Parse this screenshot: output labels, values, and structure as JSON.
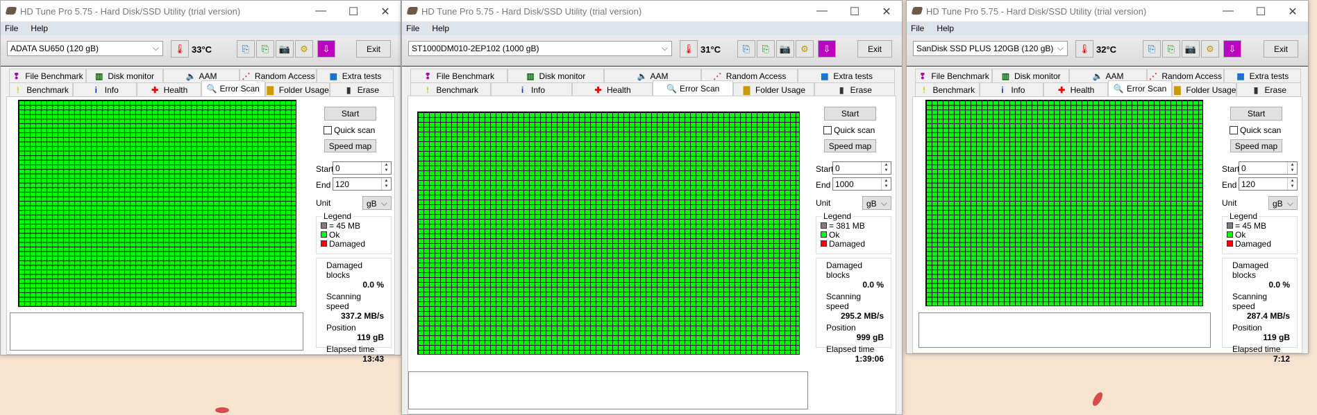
{
  "app_title": "HD Tune Pro 5.75 - Hard Disk/SSD Utility (trial version)",
  "menu": [
    "File",
    "Help"
  ],
  "exit_label": "Exit",
  "tabs_top": [
    {
      "label": "File Benchmark",
      "icon": "file-benchmark-icon"
    },
    {
      "label": "Disk monitor",
      "icon": "disk-monitor-icon"
    },
    {
      "label": "AAM",
      "icon": "speaker-icon"
    },
    {
      "label": "Random Access",
      "icon": "random-access-icon"
    },
    {
      "label": "Extra tests",
      "icon": "extra-tests-icon"
    }
  ],
  "tabs_bottom": [
    {
      "label": "Benchmark",
      "icon": "benchmark-icon"
    },
    {
      "label": "Info",
      "icon": "info-icon"
    },
    {
      "label": "Health",
      "icon": "health-cross-icon"
    },
    {
      "label": "Error Scan",
      "icon": "magnifier-icon",
      "active": true
    },
    {
      "label": "Folder Usage",
      "icon": "folder-icon"
    },
    {
      "label": "Erase",
      "icon": "trash-icon"
    }
  ],
  "panel_labels": {
    "start_button": "Start",
    "quick_scan": "Quick scan",
    "speed_map": "Speed map",
    "start": "Start",
    "end": "End",
    "unit": "Unit",
    "legend": "Legend",
    "ok": "Ok",
    "damaged": "Damaged",
    "damaged_blocks": "Damaged blocks",
    "scanning_speed": "Scanning speed",
    "position": "Position",
    "elapsed_time": "Elapsed time"
  },
  "colors": {
    "ok": "#00ff00",
    "damaged": "#ff0000",
    "block": "#808080",
    "exit_arrow": "#c000c0"
  },
  "windows": [
    {
      "drive": "ADATA SU650 (120 gB)",
      "temperature": "33°C",
      "start_value": "0",
      "end_value": "120",
      "unit": "gB",
      "block_size": "= 45 MB",
      "damaged_blocks": "0.0 %",
      "scanning_speed": "337.2 MB/s",
      "position": "119 gB",
      "elapsed_time": "13:43",
      "quick_scan_checked": false
    },
    {
      "drive": "ST1000DM010-2EP102 (1000 gB)",
      "temperature": "31°C",
      "start_value": "0",
      "end_value": "1000",
      "unit": "gB",
      "block_size": "= 381 MB",
      "damaged_blocks": "0.0 %",
      "scanning_speed": "295.2 MB/s",
      "position": "999 gB",
      "elapsed_time": "1:39:06",
      "quick_scan_checked": false
    },
    {
      "drive": "SanDisk SSD PLUS 120GB (120 gB)",
      "temperature": "32°C",
      "start_value": "0",
      "end_value": "120",
      "unit": "gB",
      "block_size": "= 45 MB",
      "damaged_blocks": "0.0 %",
      "scanning_speed": "287.4 MB/s",
      "position": "119 gB",
      "elapsed_time": "7:12",
      "quick_scan_checked": false
    }
  ]
}
